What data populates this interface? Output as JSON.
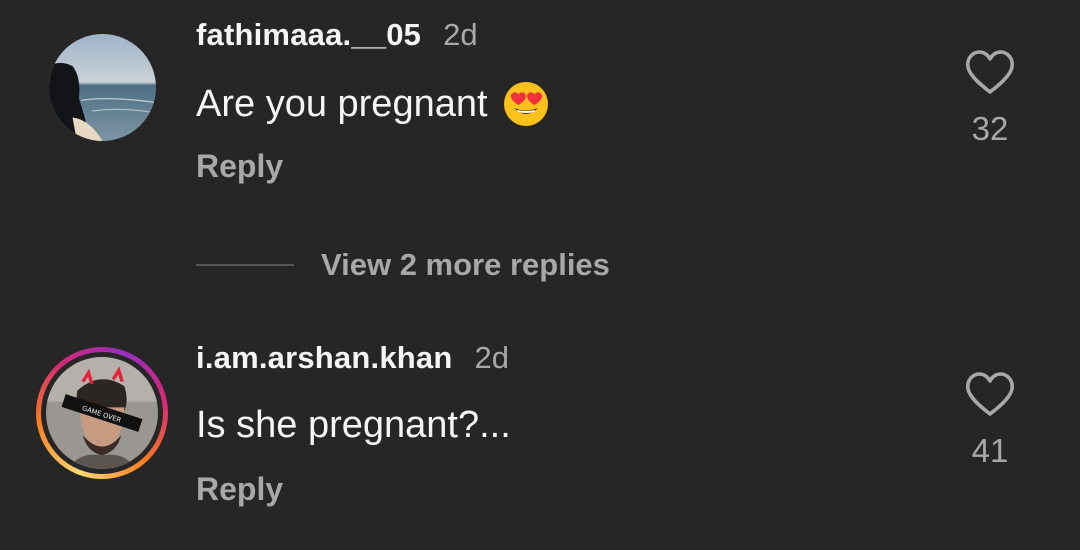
{
  "comments": [
    {
      "username": "fathimaaa.__05",
      "time": "2d",
      "text": "Are you pregnant",
      "emoji": "smiling-face-with-heart-eyes",
      "reply_label": "Reply",
      "likes": "32",
      "has_story_ring": false
    },
    {
      "username": "i.am.arshan.khan",
      "time": "2d",
      "text": "Is she pregnant?...",
      "reply_label": "Reply",
      "likes": "41",
      "has_story_ring": true,
      "avatar_overlay_text": "GAME OVER"
    }
  ],
  "view_replies_label": "View 2 more replies",
  "colors": {
    "background": "#262626",
    "primary_text": "#f5f5f5",
    "secondary_text": "#a8a8a8",
    "story_ring": [
      "#feda75",
      "#fa7e1e",
      "#d62976",
      "#962fbf"
    ]
  }
}
